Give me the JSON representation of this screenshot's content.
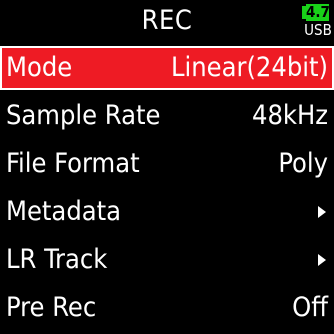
{
  "header": {
    "title": "REC"
  },
  "status": {
    "battery_value": "4.7",
    "power_source": "USB",
    "battery_color": "#19d219"
  },
  "menu": {
    "items": [
      {
        "label": "Mode",
        "value": "Linear(24bit)",
        "selected": true
      },
      {
        "label": "Sample Rate",
        "value": "48kHz"
      },
      {
        "label": "File Format",
        "value": "Poly"
      },
      {
        "label": "Metadata",
        "icon": "submenu-arrow-icon"
      },
      {
        "label": "LR Track",
        "icon": "submenu-arrow-icon"
      },
      {
        "label": "Pre Rec",
        "value": "Off"
      }
    ]
  },
  "colors": {
    "background": "#000000",
    "selected_row": "#ee1b24",
    "text": "#ffffff"
  }
}
